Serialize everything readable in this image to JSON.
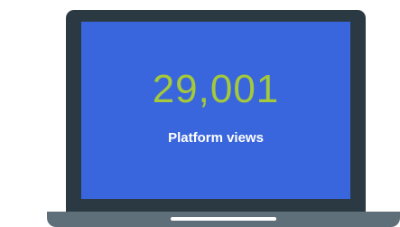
{
  "stat": {
    "value": "29,001",
    "label": "Platform views"
  },
  "colors": {
    "screen": "#3a66dd",
    "value_text": "#a4c93a",
    "label_text": "#ffffff",
    "laptop_body": "#2b3a42",
    "laptop_base": "#5f6f7a"
  }
}
